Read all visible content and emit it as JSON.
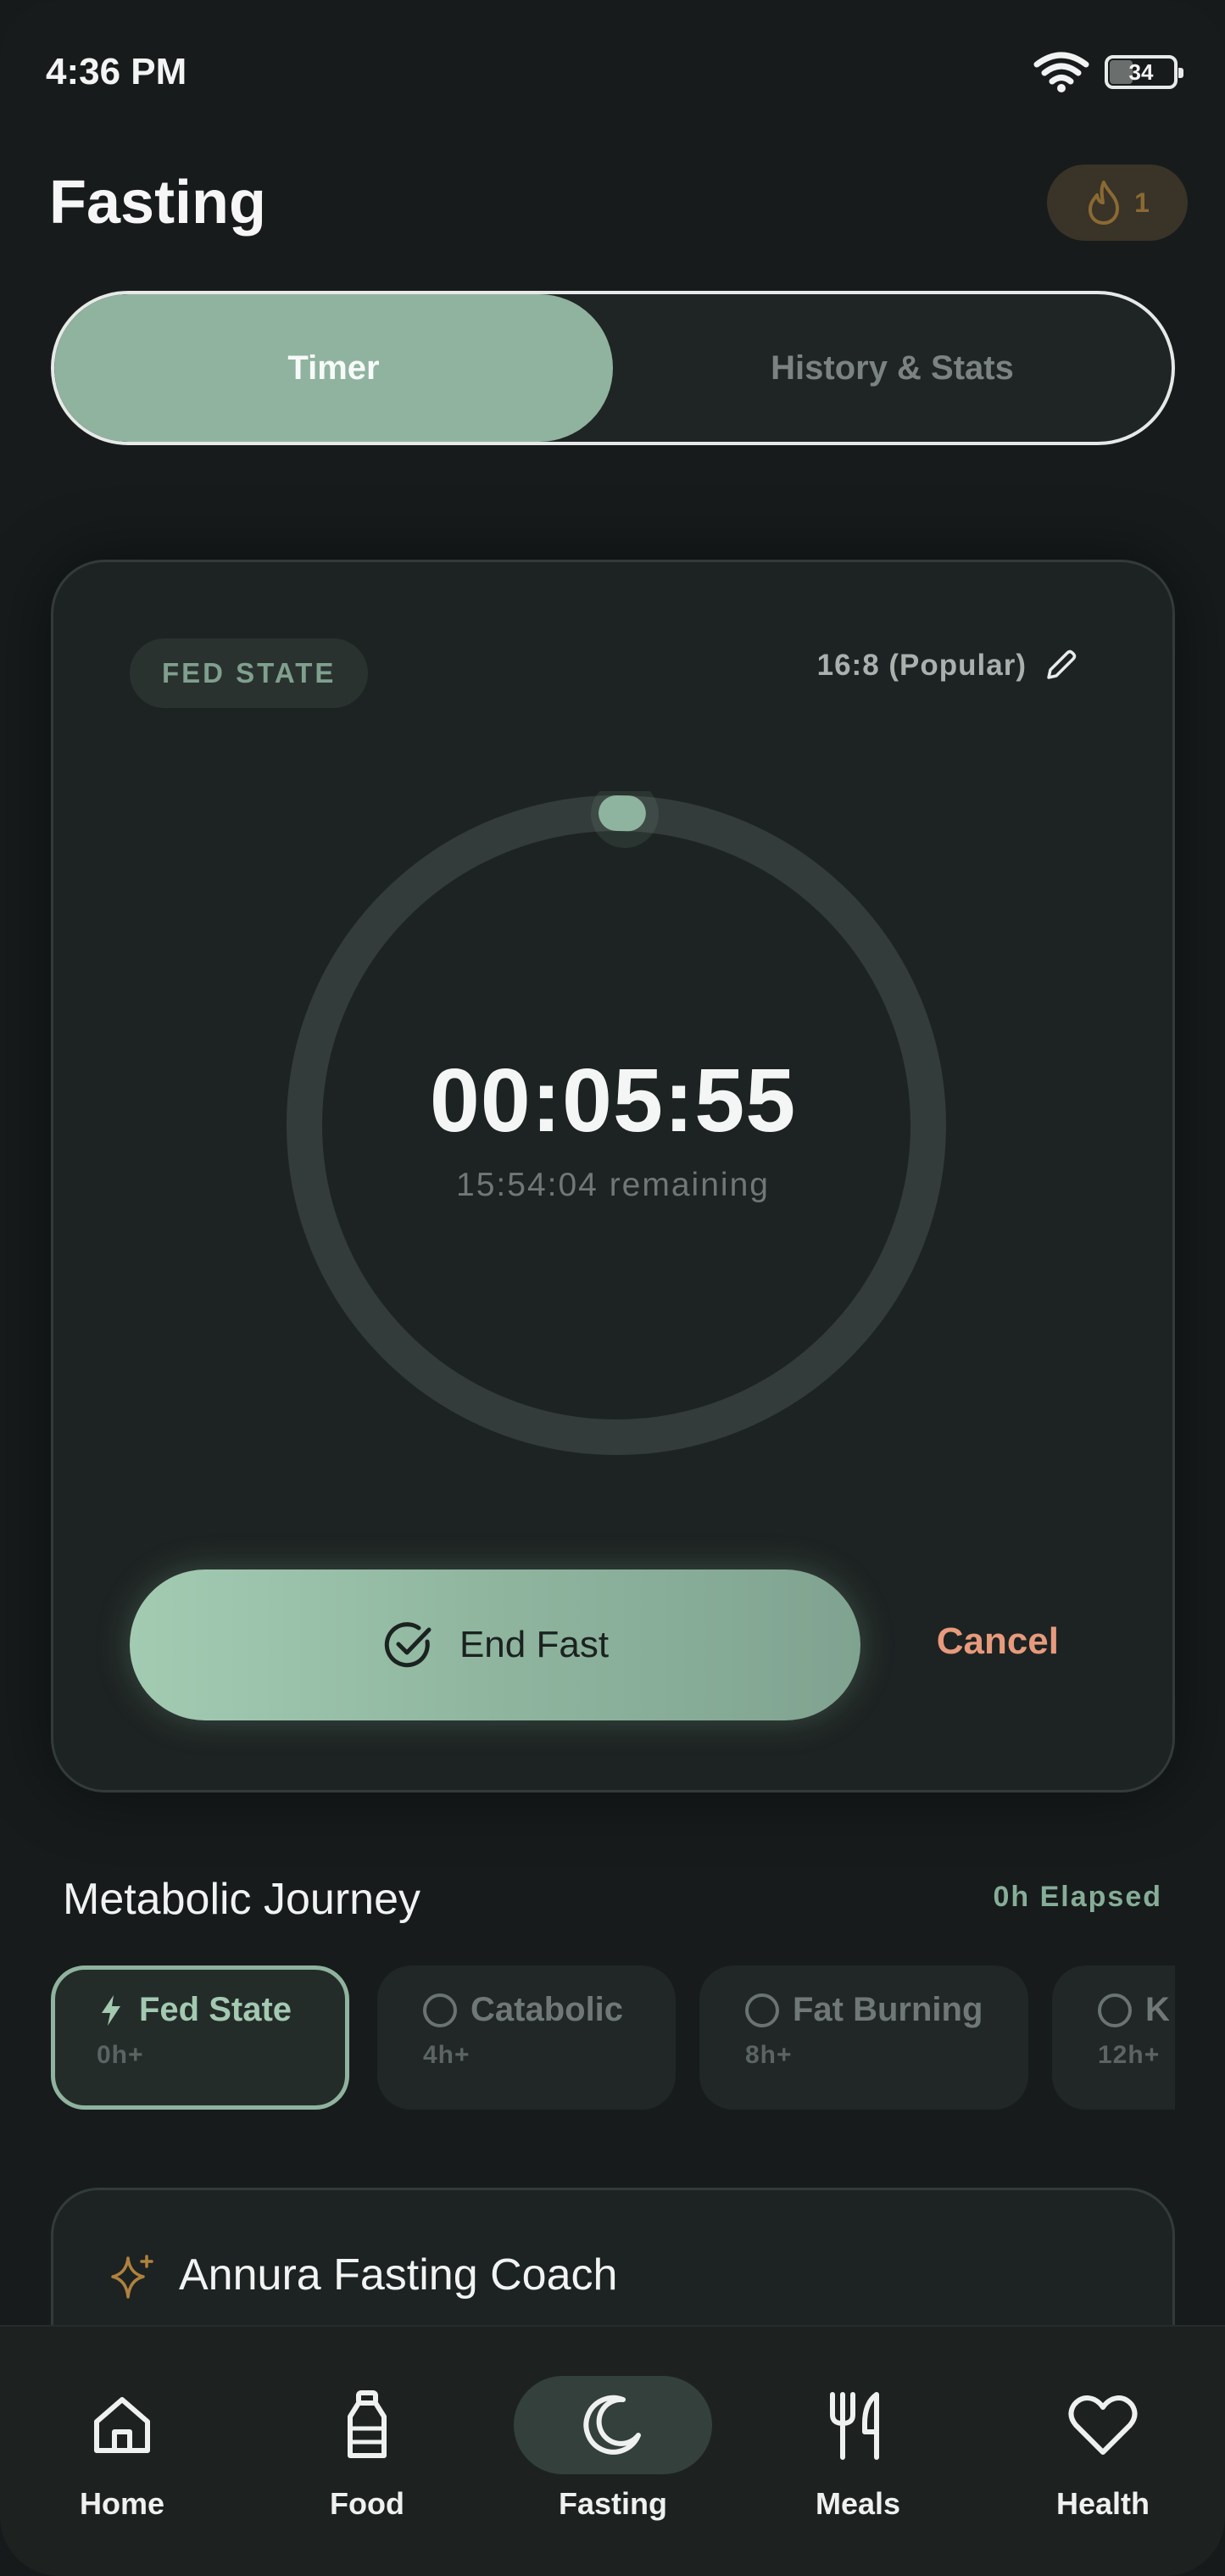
{
  "status_bar": {
    "time": "4:36 PM",
    "battery": "34"
  },
  "header": {
    "title": "Fasting",
    "streak_count": "1"
  },
  "tabs": [
    {
      "label": "Timer",
      "active": true
    },
    {
      "label": "History & Stats",
      "active": false
    }
  ],
  "timer": {
    "phase": "FED STATE",
    "plan": "16:8 (Popular)",
    "elapsed": "00:05:55",
    "remaining": "15:54:04 remaining",
    "progress": 0.006,
    "end_label": "End Fast",
    "cancel_label": "Cancel"
  },
  "journey": {
    "title": "Metabolic Journey",
    "elapsed": "0h Elapsed",
    "stages": [
      {
        "name": "Fed State",
        "sub": "0h+",
        "active": true
      },
      {
        "name": "Catabolic",
        "sub": "4h+",
        "active": false
      },
      {
        "name": "Fat Burning",
        "sub": "8h+",
        "active": false
      },
      {
        "name": "K",
        "sub": "12h+",
        "active": false
      }
    ]
  },
  "coach": {
    "title": "Annura Fasting Coach"
  },
  "nav": [
    {
      "label": "Home",
      "icon": "home-icon"
    },
    {
      "label": "Food",
      "icon": "bottle-icon"
    },
    {
      "label": "Fasting",
      "icon": "moon-icon",
      "active": true
    },
    {
      "label": "Meals",
      "icon": "utensils-icon"
    },
    {
      "label": "Health",
      "icon": "heart-icon"
    }
  ],
  "colors": {
    "accent": "#8fb39f",
    "background": "#171b1b",
    "cancel": "#e79a7c",
    "streak": "#8a6a33"
  }
}
